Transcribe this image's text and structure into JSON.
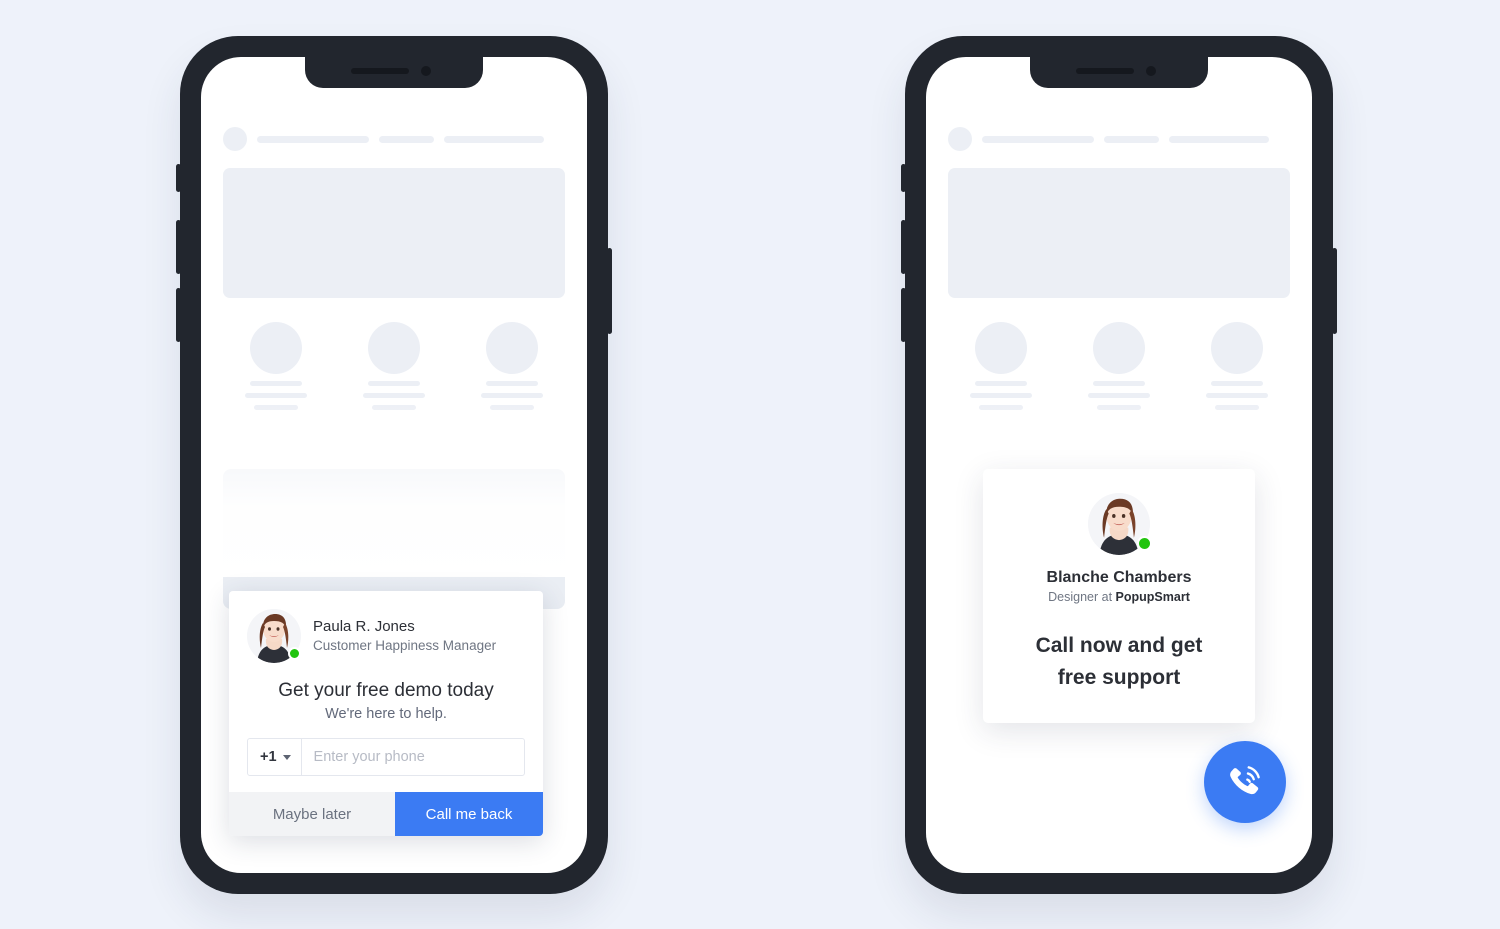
{
  "background_color": "#eef2fa",
  "accent_color": "#3b7bf3",
  "status_color": "#21c40e",
  "phones": [
    {
      "id": "phone-left",
      "popup": {
        "agent_name": "Paula R. Jones",
        "agent_role": "Customer Happiness Manager",
        "title": "Get your free demo today",
        "subtitle": "We're here to help.",
        "country_code": "+1",
        "phone_placeholder": "Enter your phone",
        "phone_value": "",
        "secondary_button": "Maybe later",
        "primary_button": "Call me back"
      }
    },
    {
      "id": "phone-right",
      "card": {
        "agent_name": "Blanche Chambers",
        "role_prefix": "Designer at ",
        "role_company": "PopupSmart",
        "title_line_1": "Call now and get",
        "title_line_2": "free support"
      },
      "fab": {
        "icon": "phone-call-icon",
        "label": "Call now"
      }
    }
  ]
}
